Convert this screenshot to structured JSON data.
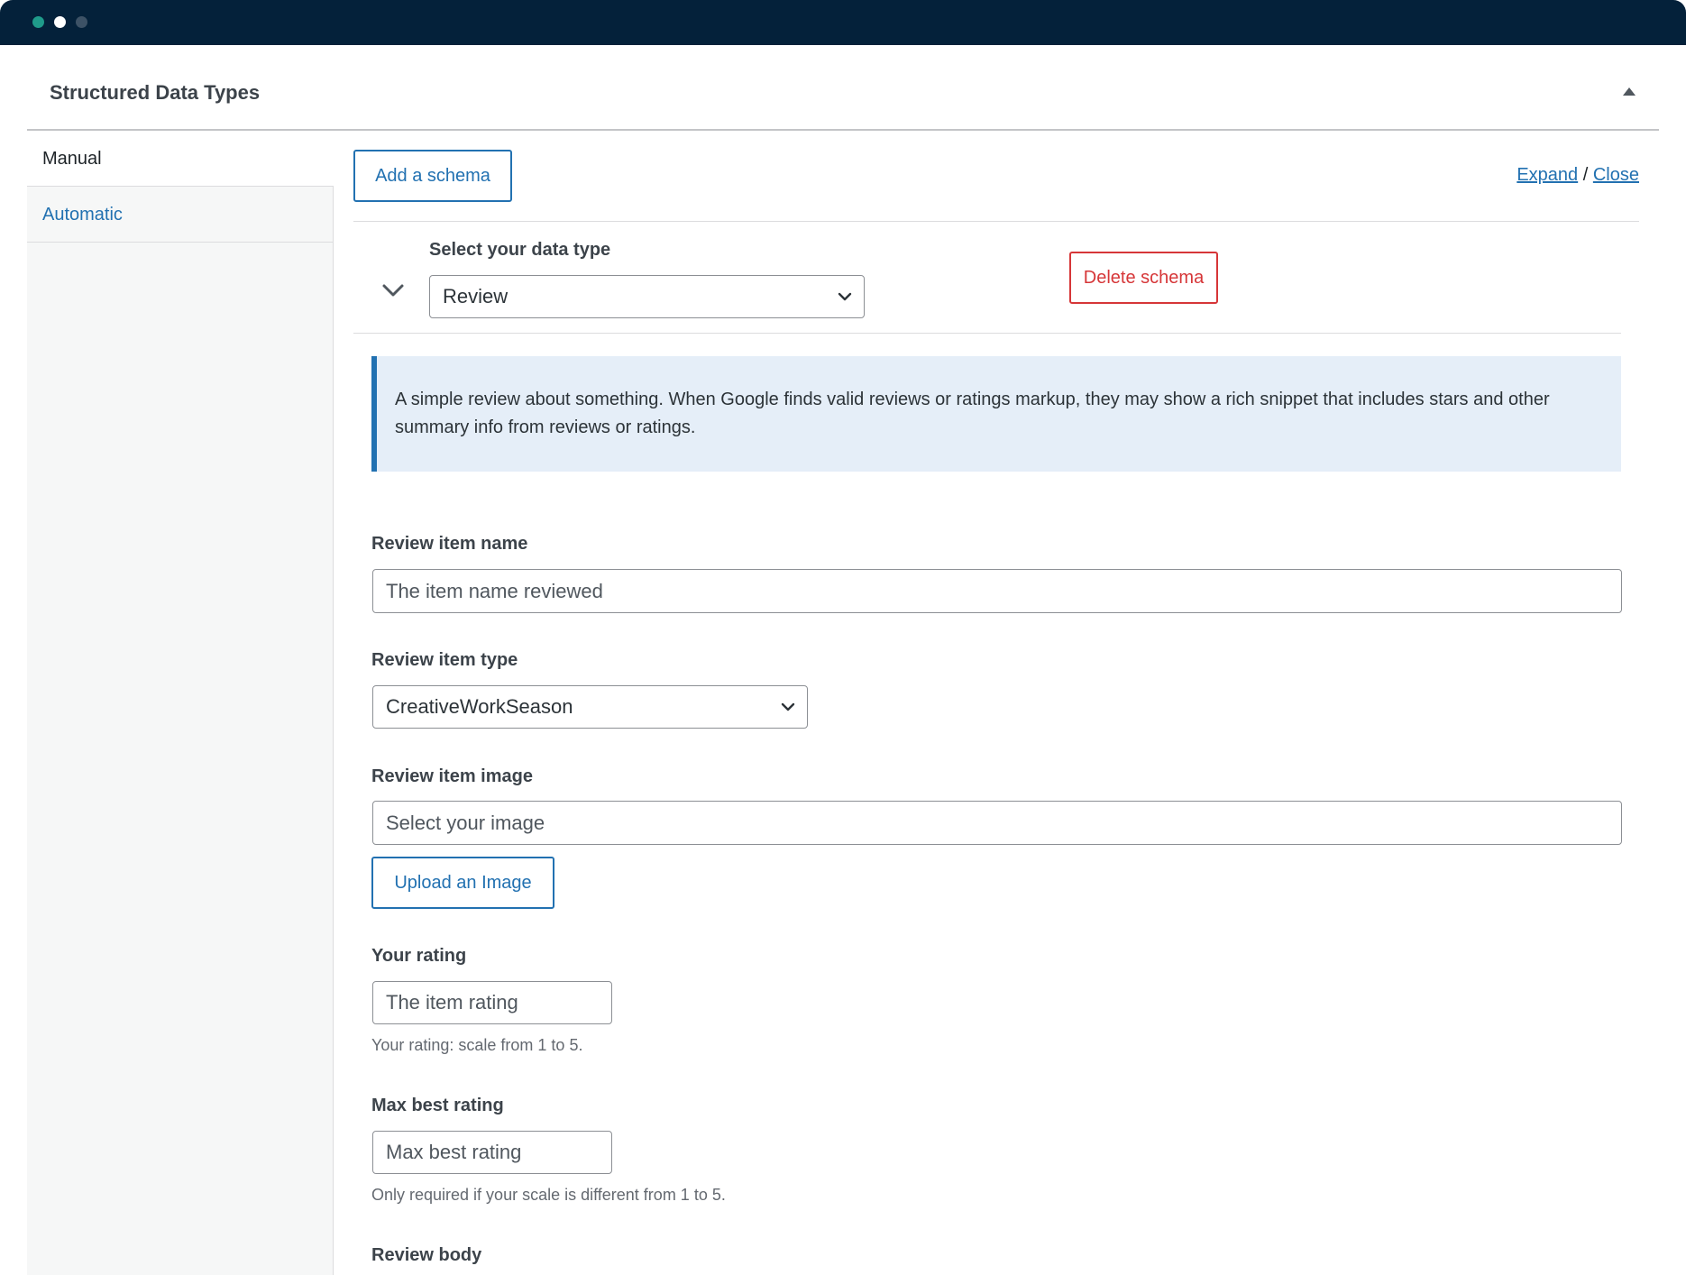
{
  "window": {
    "dots": [
      "#1f9b8a",
      "#ffffff",
      "#3d5266"
    ]
  },
  "panel": {
    "title": "Structured Data Types"
  },
  "sidebar": {
    "items": [
      {
        "label": "Manual",
        "active": true
      },
      {
        "label": "Automatic",
        "active": false
      }
    ]
  },
  "toolbar": {
    "add_schema_label": "Add a schema",
    "expand_label": "Expand",
    "separator": "/",
    "close_label": "Close"
  },
  "schema": {
    "data_type_label": "Select your data type",
    "data_type_value": "Review",
    "delete_label": "Delete schema",
    "description": "A simple review about something. When Google finds valid reviews or ratings markup, they may show a rich snippet that includes stars and other summary info from reviews or ratings."
  },
  "fields": {
    "item_name": {
      "label": "Review item name",
      "placeholder": "The item name reviewed"
    },
    "item_type": {
      "label": "Review item type",
      "value": "CreativeWorkSeason"
    },
    "item_image": {
      "label": "Review item image",
      "placeholder": "Select your image",
      "upload_label": "Upload an Image"
    },
    "rating": {
      "label": "Your rating",
      "placeholder": "The item rating",
      "help": "Your rating: scale from 1 to 5."
    },
    "max_rating": {
      "label": "Max best rating",
      "placeholder": "Max best rating",
      "help": "Only required if your scale is different from 1 to 5."
    },
    "review_body": {
      "label": "Review body"
    }
  },
  "colors": {
    "titlebar": "#04213a",
    "accent": "#2271b1",
    "danger": "#d63638",
    "notice_bg": "#e5eef8"
  }
}
